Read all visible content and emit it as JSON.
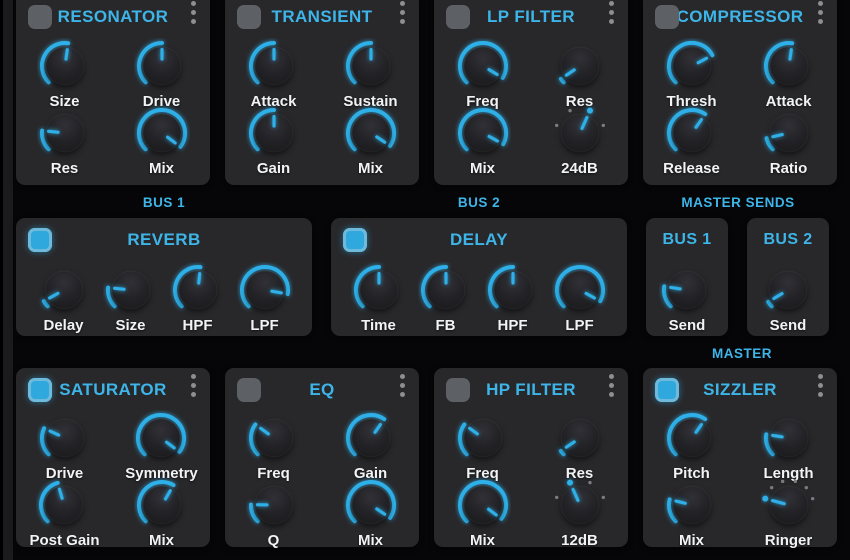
{
  "theme": {
    "accent": "#3db5e8",
    "knob_arc": "#2fb0e8",
    "module_bg": "#28282b",
    "label_text": "#f2f3f5"
  },
  "labels": {
    "bus1": "BUS 1",
    "bus2": "BUS 2",
    "master_sends": "MASTER SENDS",
    "master": "MASTER"
  },
  "top_row": {
    "modules": [
      {
        "title": "RESONATOR",
        "enabled": false,
        "has_checkbox": true,
        "has_menu": true,
        "layout": "grid2",
        "knobs": [
          {
            "label": "Size",
            "angle": 8
          },
          {
            "label": "Drive",
            "angle": 0
          },
          {
            "label": "Res",
            "angle": -84
          },
          {
            "label": "Mix",
            "angle": 127
          }
        ]
      },
      {
        "title": "TRANSIENT",
        "enabled": false,
        "has_checkbox": true,
        "has_menu": true,
        "layout": "grid2",
        "knobs": [
          {
            "label": "Attack",
            "angle": 0
          },
          {
            "label": "Sustain",
            "angle": 0
          },
          {
            "label": "Gain",
            "angle": 0
          },
          {
            "label": "Mix",
            "angle": 124
          }
        ]
      },
      {
        "title": "LP FILTER",
        "enabled": false,
        "has_checkbox": true,
        "has_menu": true,
        "layout": "grid2",
        "knobs": [
          {
            "label": "Freq",
            "angle": 121
          },
          {
            "label": "Res",
            "angle": -124
          },
          {
            "label": "Mix",
            "angle": 119
          },
          {
            "label": "24dB",
            "stepped": true,
            "steps": 4,
            "selected": 2,
            "angle": 24
          }
        ]
      },
      {
        "title": "COMPRESSOR",
        "enabled": false,
        "has_checkbox": true,
        "has_menu": true,
        "layout": "grid2",
        "knobs": [
          {
            "label": "Thresh",
            "angle": 62
          },
          {
            "label": "Attack",
            "angle": 8
          },
          {
            "label": "Release",
            "angle": 35
          },
          {
            "label": "Ratio",
            "angle": -103
          }
        ]
      }
    ]
  },
  "mid_row": {
    "modules": [
      {
        "title": "REVERB",
        "enabled": true,
        "has_checkbox": true,
        "has_menu": false,
        "layout": "row4",
        "size": "wide",
        "knobs": [
          {
            "label": "Delay",
            "angle": -119
          },
          {
            "label": "Size",
            "angle": -84
          },
          {
            "label": "HPF",
            "angle": 6
          },
          {
            "label": "LPF",
            "angle": 100
          }
        ]
      },
      {
        "title": "DELAY",
        "enabled": true,
        "has_checkbox": true,
        "has_menu": false,
        "layout": "row4",
        "size": "wide",
        "knobs": [
          {
            "label": "Time",
            "angle": 0
          },
          {
            "label": "FB",
            "angle": 0
          },
          {
            "label": "HPF",
            "angle": 0
          },
          {
            "label": "LPF",
            "angle": 119
          }
        ]
      },
      {
        "title": "BUS 1",
        "enabled": null,
        "has_checkbox": false,
        "has_menu": false,
        "layout": "single",
        "size": "small",
        "knobs": [
          {
            "label": "Send",
            "angle": -81
          }
        ]
      },
      {
        "title": "BUS 2",
        "enabled": null,
        "has_checkbox": false,
        "has_menu": false,
        "layout": "single",
        "size": "small",
        "knobs": [
          {
            "label": "Send",
            "angle": -121
          }
        ]
      }
    ]
  },
  "bottom_row": {
    "modules": [
      {
        "title": "SATURATOR",
        "enabled": true,
        "has_checkbox": true,
        "has_menu": true,
        "layout": "grid2",
        "knobs": [
          {
            "label": "Drive",
            "angle": -65
          },
          {
            "label": "Symmetry",
            "angle": 127
          },
          {
            "label": "Post Gain",
            "angle": -16
          },
          {
            "label": "Mix",
            "angle": 30
          }
        ]
      },
      {
        "title": "EQ",
        "enabled": false,
        "has_checkbox": true,
        "has_menu": true,
        "layout": "grid2",
        "knobs": [
          {
            "label": "Freq",
            "angle": -54
          },
          {
            "label": "Gain",
            "angle": 35
          },
          {
            "label": "Q",
            "angle": -89
          },
          {
            "label": "Mix",
            "angle": 124
          }
        ]
      },
      {
        "title": "HP FILTER",
        "enabled": false,
        "has_checkbox": true,
        "has_menu": true,
        "layout": "grid2",
        "knobs": [
          {
            "label": "Freq",
            "angle": -54
          },
          {
            "label": "Res",
            "angle": -124
          },
          {
            "label": "Mix",
            "angle": 127
          },
          {
            "label": "12dB",
            "stepped": true,
            "steps": 4,
            "selected": 1,
            "angle": -24
          }
        ]
      },
      {
        "title": "SIZZLER",
        "enabled": true,
        "has_checkbox": true,
        "has_menu": true,
        "layout": "grid2",
        "knobs": [
          {
            "label": "Pitch",
            "angle": 35
          },
          {
            "label": "Length",
            "angle": -81
          },
          {
            "label": "Mix",
            "angle": -76
          },
          {
            "label": "Ringer",
            "stepped": true,
            "steps": 6,
            "selected": 0,
            "angle": -75
          }
        ]
      }
    ]
  }
}
